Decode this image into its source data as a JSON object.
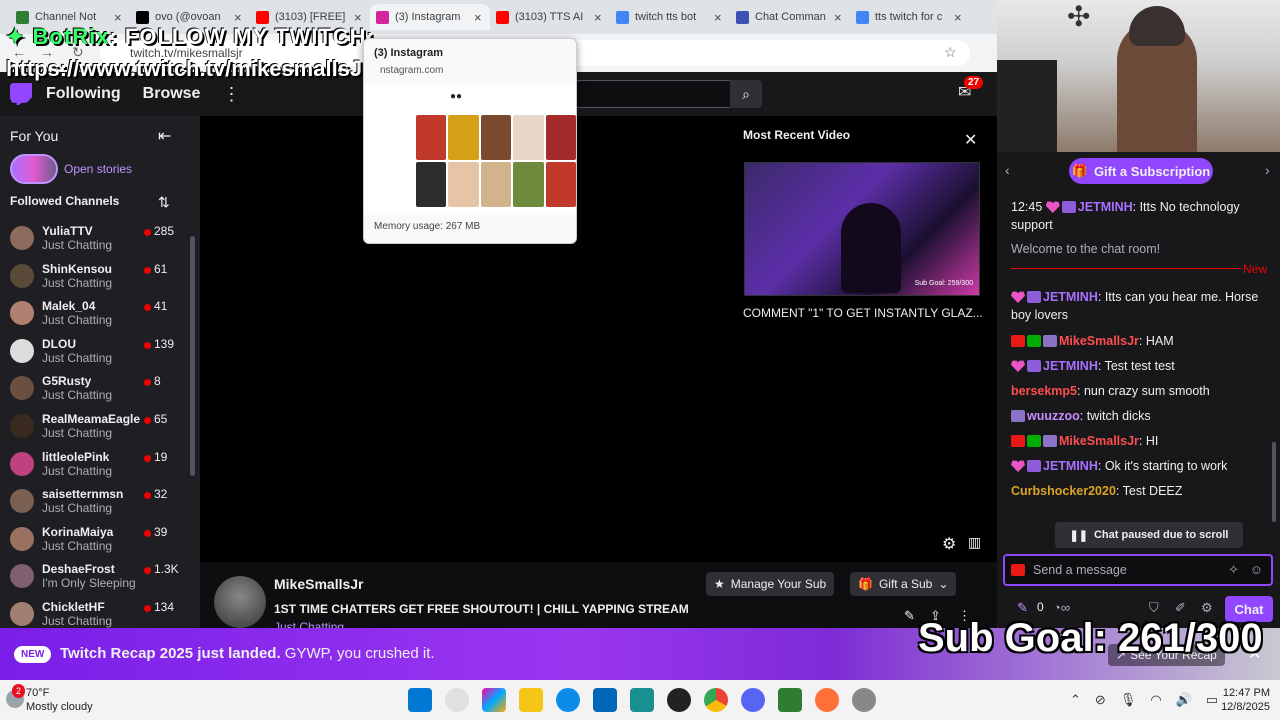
{
  "overlay": {
    "bot_name": "BotRix",
    "bot_message": "FOLLOW MY TWITCH:",
    "twitch_url": "https://www.twitch.tv/mikesmallsJr",
    "sub_goal": "Sub Goal: 261/300"
  },
  "browser": {
    "tabs": [
      {
        "label": "Channel Not",
        "color": "#2e7d32"
      },
      {
        "label": "ovo (@ovoan",
        "color": "#000000"
      },
      {
        "label": "(3103) [FREE]",
        "color": "#ff0000"
      },
      {
        "label": "(3) Instagram",
        "color": "#d6249f"
      },
      {
        "label": "(3103) TTS AI",
        "color": "#ff0000"
      },
      {
        "label": "twitch tts bot",
        "color": "#4285f4"
      },
      {
        "label": "Chat Comman",
        "color": "#3f51b5"
      },
      {
        "label": "tts twitch for c",
        "color": "#4285f4"
      }
    ],
    "url": "twitch.tv/mikesmallsjr"
  },
  "tab_preview": {
    "title": "(3) Instagram",
    "domain": "nstagram.com",
    "memory": "Memory usage: 267 MB"
  },
  "twitch_nav": {
    "following": "Following",
    "browse": "Browse",
    "notifications": "27"
  },
  "sidebar": {
    "for_you": "For You",
    "open_stories": "Open stories",
    "followed_header": "Followed Channels",
    "channels": [
      {
        "name": "YuliaTTV",
        "game": "Just Chatting",
        "viewers": "285",
        "color": "#8a6b5c"
      },
      {
        "name": "ShinKensou",
        "game": "Just Chatting",
        "viewers": "61",
        "color": "#5a4a3a"
      },
      {
        "name": "Malek_04",
        "game": "Just Chatting",
        "viewers": "41",
        "color": "#b08070"
      },
      {
        "name": "DLOU",
        "game": "Just Chatting",
        "viewers": "139",
        "color": "#dcdcdc"
      },
      {
        "name": "G5Rusty",
        "game": "Just Chatting",
        "viewers": "8",
        "color": "#6a5040"
      },
      {
        "name": "RealMeamaEagle",
        "game": "Just Chatting",
        "viewers": "65",
        "color": "#3a2a20"
      },
      {
        "name": "littleolePink",
        "game": "Just Chatting",
        "viewers": "19",
        "color": "#c04080"
      },
      {
        "name": "saisetternmsn",
        "game": "Just Chatting",
        "viewers": "32",
        "color": "#7a6050"
      },
      {
        "name": "KorinaMaiya",
        "game": "Just Chatting",
        "viewers": "39",
        "color": "#9a7060"
      },
      {
        "name": "DeshaeFrost",
        "game": "I'm Only Sleeping",
        "viewers": "1.3K",
        "color": "#806070"
      },
      {
        "name": "ChickletHF",
        "game": "Just Chatting",
        "viewers": "134",
        "color": "#a08070"
      }
    ]
  },
  "player": {
    "most_recent_title": "Most Recent Video",
    "video_goal": "Sub Goal: 259/300",
    "video_caption": "COMMENT \"1\" TO GET INSTANTLY GLAZ..."
  },
  "stream": {
    "name": "MikeSmallsJr",
    "title": "1ST TIME CHATTERS GET FREE SHOUTOUT! | CHILL YAPPING STREAM",
    "category": "Just Chatting",
    "manage_sub": "Manage Your Sub",
    "gift_sub": "Gift a Sub"
  },
  "chat": {
    "gift_subscription": "Gift a Subscription",
    "new_label": "New",
    "paused": "Chat paused due to scroll",
    "placeholder": "Send a message",
    "points": "0",
    "chat_button": "Chat",
    "messages": [
      {
        "time": "12:45",
        "user": "JETMINH",
        "text": ": Itts No technology support"
      },
      {
        "text": "Welcome to the chat room!"
      },
      {
        "user": "JETMINH",
        "text": ": Itts can you hear me. Horse boy lovers"
      },
      {
        "user": "MikeSmallsJr",
        "text": ": HAM"
      },
      {
        "user": "JETMINH",
        "text": ": Test test test"
      },
      {
        "user": "bersekmp5",
        "text": ": nun crazy sum smooth"
      },
      {
        "user": "wuuzzoo",
        "text": ": twitch dicks"
      },
      {
        "user": "MikeSmallsJr",
        "text": ": HI"
      },
      {
        "user": "JETMINH",
        "text": ": Ok it's starting to work"
      },
      {
        "user": "Curbshocker2020",
        "text": ": Test DEEZ"
      }
    ]
  },
  "banner": {
    "new_tag": "NEW",
    "headline": "Twitch Recap 2025 just landed.",
    "sub": " GYWP, you crushed it.",
    "see_recap": "See Your Recap"
  },
  "taskbar": {
    "weather_badge": "2",
    "temp": "70°F",
    "condition": "Mostly cloudy",
    "time": "12:47 PM",
    "date": "12/8/2025"
  }
}
